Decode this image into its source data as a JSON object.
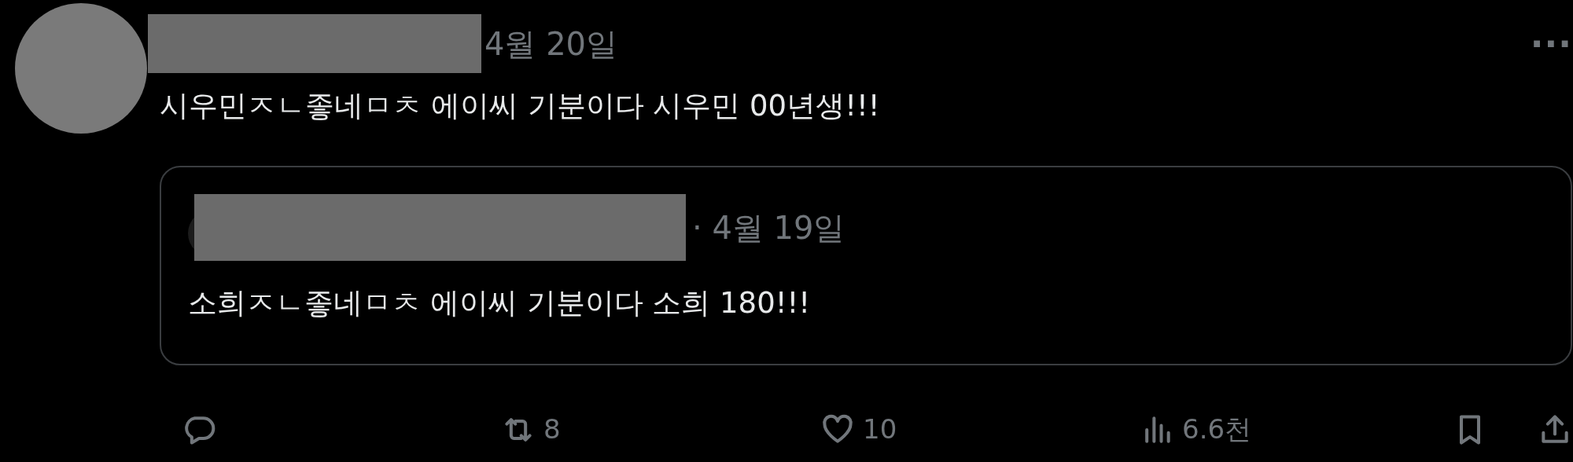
{
  "post": {
    "author": {
      "redacted": true
    },
    "date": "4월 20일",
    "more": "···",
    "text": "시우민ㅈㄴ좋네ㅁㅊ 에이씨 기분이다 시우민 00년생!!!"
  },
  "quote": {
    "author": {
      "redacted": true
    },
    "date": "· 4월 19일",
    "text": "소희ㅈㄴ좋네ㅁㅊ 에이씨 기분이다 소희 180!!!"
  },
  "actions": [
    {
      "kind": "reply"
    },
    {
      "kind": "repost",
      "count": "8"
    },
    {
      "kind": "like",
      "count": "10"
    },
    {
      "kind": "views",
      "count": "6.6천"
    },
    {
      "kind": "bookmark"
    },
    {
      "kind": "share"
    }
  ]
}
